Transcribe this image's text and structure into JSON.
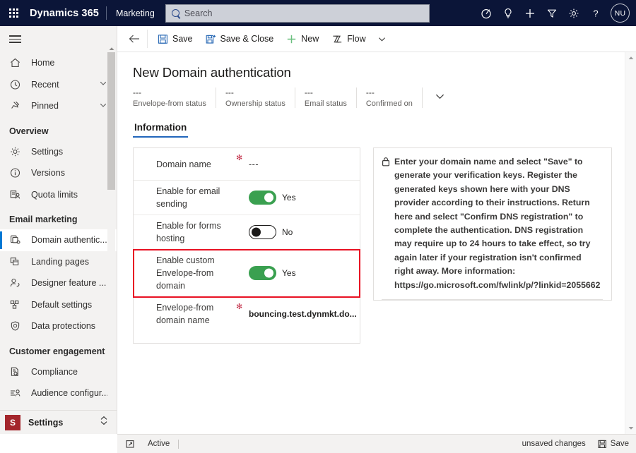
{
  "topbar": {
    "waffle_label": "app-launcher",
    "brand": "Dynamics 365",
    "app_name": "Marketing",
    "search_placeholder": "Search",
    "icons": [
      {
        "name": "assistant-icon",
        "label": "Relevance search"
      },
      {
        "name": "lightbulb-icon",
        "label": "Insights"
      },
      {
        "name": "plus-icon",
        "label": "Quick create"
      },
      {
        "name": "filter-icon",
        "label": "Filter"
      },
      {
        "name": "gear-icon",
        "label": "Settings"
      },
      {
        "name": "question-icon",
        "label": "Help"
      }
    ],
    "avatar_initials": "NU"
  },
  "sidebar": {
    "hamburger_label": "Expand or collapse site map",
    "primary": [
      {
        "label": "Home",
        "icon": "home-icon",
        "chevron": false
      },
      {
        "label": "Recent",
        "icon": "clock-icon",
        "chevron": true
      },
      {
        "label": "Pinned",
        "icon": "pin-icon",
        "chevron": true
      }
    ],
    "groups": [
      {
        "title": "Overview",
        "items": [
          {
            "label": "Settings",
            "icon": "gear-icon",
            "selected": false
          },
          {
            "label": "Versions",
            "icon": "info-circle-icon",
            "selected": false
          },
          {
            "label": "Quota limits",
            "icon": "quota-icon",
            "selected": false
          }
        ]
      },
      {
        "title": "Email marketing",
        "items": [
          {
            "label": "Domain authentic...",
            "icon": "domain-icon",
            "selected": true
          },
          {
            "label": "Landing pages",
            "icon": "pages-icon",
            "selected": false
          },
          {
            "label": "Designer feature ...",
            "icon": "person-check-icon",
            "selected": false
          },
          {
            "label": "Default settings",
            "icon": "grid-shapes-icon",
            "selected": false
          },
          {
            "label": "Data protections",
            "icon": "shield-icon",
            "selected": false
          }
        ]
      },
      {
        "title": "Customer engagement",
        "items": [
          {
            "label": "Compliance",
            "icon": "document-search-icon",
            "selected": false
          },
          {
            "label": "Audience configur...",
            "icon": "audience-icon",
            "selected": false
          }
        ]
      }
    ],
    "footer": {
      "app_initial": "S",
      "app_label": "Settings",
      "switcher_icon": "app-switcher-icon"
    }
  },
  "commandbar": {
    "back_label": "Back",
    "buttons": [
      {
        "label": "Save",
        "icon": "save-icon"
      },
      {
        "label": "Save & Close",
        "icon": "save-close-icon"
      },
      {
        "label": "New",
        "icon": "plus-icon"
      },
      {
        "label": "Flow",
        "icon": "flow-icon"
      }
    ],
    "overflow_label": "More commands"
  },
  "page": {
    "title": "New Domain authentication",
    "header_stats": [
      {
        "value": "---",
        "label": "Envelope-from status"
      },
      {
        "value": "---",
        "label": "Ownership status"
      },
      {
        "value": "---",
        "label": "Email status"
      },
      {
        "value": "---",
        "label": "Confirmed on"
      }
    ],
    "tabs": [
      {
        "label": "Information",
        "active": true
      }
    ]
  },
  "form": {
    "rows": [
      {
        "label": "Domain name",
        "required": true,
        "type": "text",
        "value": "---",
        "highlighted": false
      },
      {
        "label": "Enable for email sending",
        "required": false,
        "type": "toggle",
        "toggle_on": true,
        "value": "Yes",
        "highlighted": false
      },
      {
        "label": "Enable for forms hosting",
        "required": false,
        "type": "toggle",
        "toggle_on": false,
        "value": "No",
        "highlighted": false
      },
      {
        "label": "Enable custom Envelope-from domain",
        "required": false,
        "type": "toggle",
        "toggle_on": true,
        "value": "Yes",
        "highlighted": true
      },
      {
        "label": "Envelope-from domain name",
        "required": true,
        "type": "text-bold",
        "value": "bouncing.test.dynmkt.do...",
        "highlighted": false
      }
    ],
    "highlight_color": "#e81123",
    "toggle_on_color": "#3aa050"
  },
  "info_panel": {
    "icon": "lock-icon",
    "text": "Enter your domain name and select \"Save\" to generate your verification keys. Register the generated keys shown here with your DNS provider according to their instructions. Return here and select \"Confirm DNS registration\" to complete the authentication. DNS registration may require up to 24 hours to take effect, so try again later if your registration isn't confirmed right away. More information: https://go.microsoft.com/fwlink/p/?linkid=2055662"
  },
  "statusbar": {
    "expand_icon": "expand-icon",
    "state": "Active",
    "unsaved_text": "unsaved changes",
    "save_label": "Save",
    "save_icon": "save-icon"
  }
}
